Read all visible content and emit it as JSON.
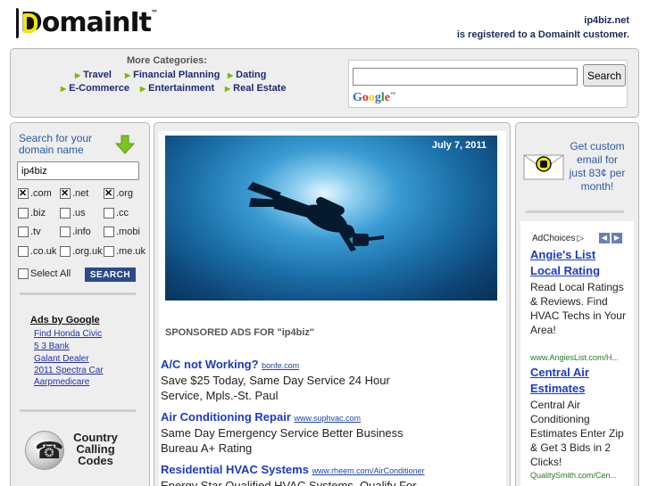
{
  "header": {
    "logo_text": "DomainIt",
    "logo_tm": "™",
    "domain": "ip4biz.net",
    "registered_text": "is registered to a DomainIt customer."
  },
  "categories": {
    "heading": "More Categories:",
    "items": [
      "Travel",
      "Financial Planning",
      "Dating",
      "E-Commerce",
      "Entertainment",
      "Real Estate"
    ]
  },
  "google_search": {
    "button_label": "Search",
    "input_value": "",
    "logo_letters": [
      "G",
      "o",
      "o",
      "g",
      "l",
      "e"
    ],
    "logo_tm": "™"
  },
  "domain_search": {
    "title": "Search for your domain name",
    "input_value": "ip4biz",
    "tlds": [
      {
        "label": ".com",
        "checked": true
      },
      {
        "label": ".net",
        "checked": true
      },
      {
        "label": ".org",
        "checked": true
      },
      {
        "label": ".biz",
        "checked": false
      },
      {
        "label": ".us",
        "checked": false
      },
      {
        "label": ".cc",
        "checked": false
      },
      {
        "label": ".tv",
        "checked": false
      },
      {
        "label": ".info",
        "checked": false
      },
      {
        "label": ".mobi",
        "checked": false
      },
      {
        "label": ".co.uk",
        "checked": false
      },
      {
        "label": ".org.uk",
        "checked": false
      },
      {
        "label": ".me.uk",
        "checked": false
      }
    ],
    "select_all_label": "Select All",
    "search_button": "SEARCH"
  },
  "ads_by_google": {
    "title": "Ads by Google",
    "links": [
      "Find Honda Civic",
      "5 3 Bank",
      "Galant Dealer",
      "2011 Spectra Car",
      "Aarpmedicare"
    ]
  },
  "calling_codes": {
    "line1": "Country",
    "line2": "Calling",
    "line3": "Codes"
  },
  "main": {
    "date": "July 7, 2011",
    "sponsored_heading": "SPONSORED ADS FOR \"ip4biz\"",
    "ads": [
      {
        "title": "A/C not Working?",
        "url": "bonfe.com",
        "desc": "Save $25 Today, Same Day Service 24 Hour Service, Mpls.-St. Paul"
      },
      {
        "title": "Air Conditioning Repair",
        "url": "www.suphvac.com",
        "desc": "Same Day Emergency Service Better Business Bureau A+ Rating"
      },
      {
        "title": "Residential HVAC Systems",
        "url": "www.rheem.com/AirConditioner",
        "desc": "Energy Star Qualified HVAC Systems. Qualify For"
      }
    ]
  },
  "right": {
    "email_promo": "Get custom email for just 83¢ per month!",
    "adchoices_label": "AdChoices",
    "ads": [
      {
        "title": "Angie's List Local Rating",
        "desc": "Read Local Ratings & Reviews. Find HVAC Techs in Your Area!",
        "url": "www.AngiesList.com/H..."
      },
      {
        "title": "Central Air Estimates",
        "desc": "Central Air Conditioning Estimates Enter Zip & Get 3 Bids in 2 Clicks!",
        "url": "QualitySmith.com/Cen..."
      }
    ]
  }
}
